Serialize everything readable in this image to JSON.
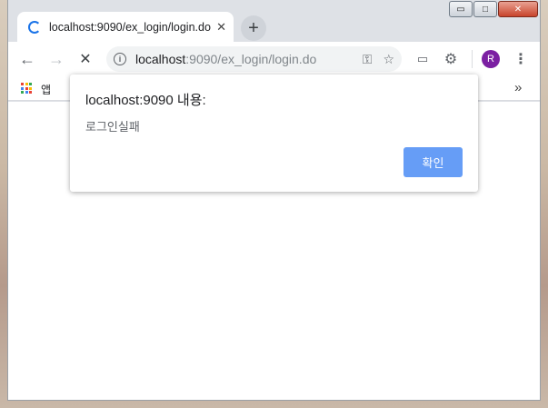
{
  "window": {
    "controls": {
      "minimize": "▭",
      "maximize": "□",
      "close": "✕"
    }
  },
  "tab": {
    "title": "localhost:9090/ex_login/login.do",
    "close": "✕",
    "loading_icon": "spinner-icon"
  },
  "new_tab": {
    "label": "+"
  },
  "toolbar": {
    "back": "←",
    "forward": "→",
    "stop": "✕",
    "info": "i",
    "url_host": "localhost",
    "url_rest": ":9090/ex_login/login.do",
    "key_icon": "⚿",
    "star_icon": "☆",
    "cast_icon": "▭",
    "extension_icon": "⚙",
    "avatar_initial": "R",
    "menu": "⋮"
  },
  "bookmarks": {
    "apps_label": "앱",
    "more": "»",
    "apps_colors": [
      "#ea4335",
      "#fbbc05",
      "#34a853",
      "#4285f4",
      "#ea4335",
      "#fbbc05",
      "#34a853",
      "#4285f4",
      "#ea4335"
    ]
  },
  "dialog": {
    "title": "localhost:9090 내용:",
    "message": "로그인실패",
    "ok_label": "확인"
  },
  "colors": {
    "accent": "#669df6",
    "avatar": "#7b1fa2",
    "spinner": "#1a73e8"
  }
}
